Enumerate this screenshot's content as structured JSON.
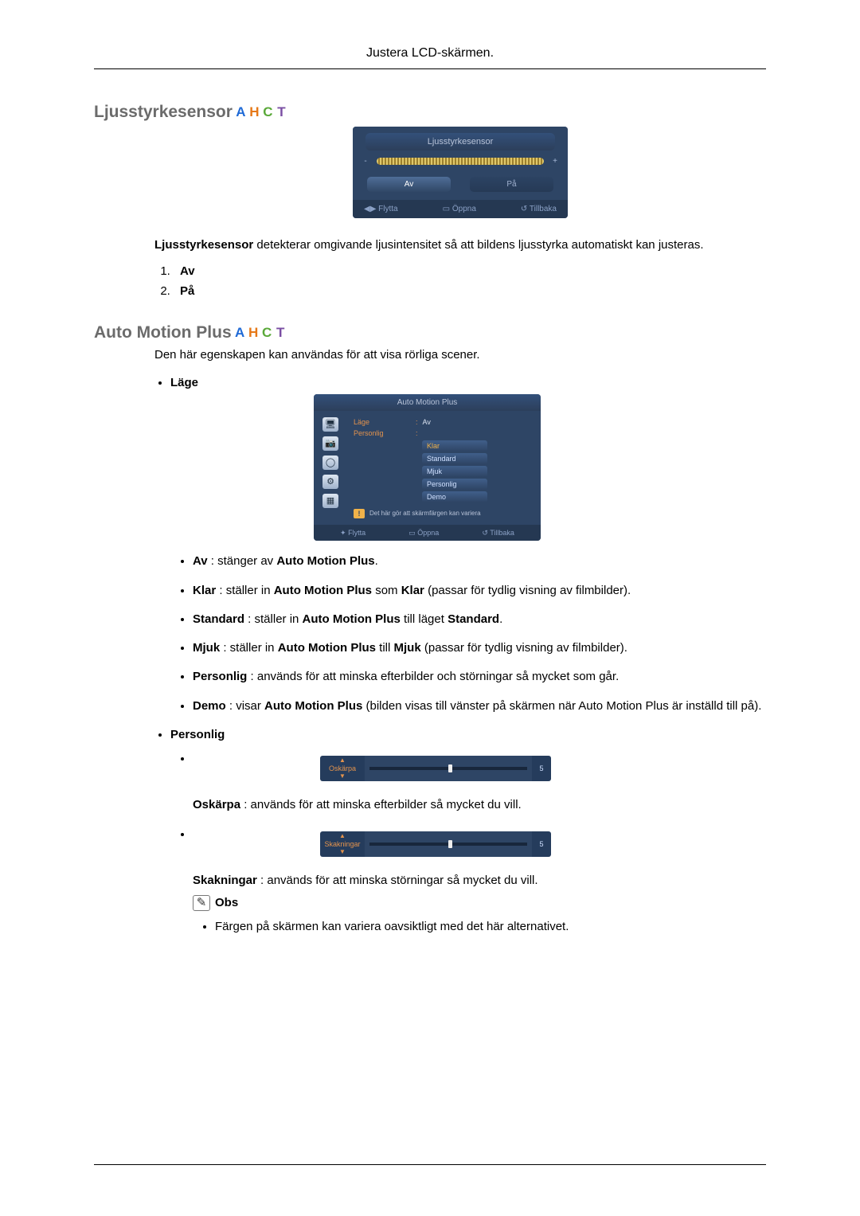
{
  "header": {
    "title": "Justera LCD-skärmen."
  },
  "section1": {
    "title": "Ljusstyrkesensor",
    "osd": {
      "title": "Ljusstyrkesensor",
      "minus": "-",
      "plus": "+",
      "opt_av": "Av",
      "opt_pa": "På",
      "foot_move": "Flytta",
      "foot_open": "Öppna",
      "foot_back": "Tillbaka"
    },
    "desc_pre": "Ljusstyrkesensor",
    "desc_post": " detekterar omgivande ljusintensitet så att bildens ljusstyrka automatiskt kan justeras.",
    "list": {
      "i1": "Av",
      "i2": "På"
    }
  },
  "section2": {
    "title": "Auto Motion Plus",
    "intro": "Den här egenskapen kan användas för att visa rörliga scener.",
    "mode_label": "Läge",
    "osd": {
      "title": "Auto Motion Plus",
      "row_mode": "Läge",
      "row_mode_val": "Av",
      "row_pers": "Personlig",
      "opts": {
        "klar": "Klar",
        "standard": "Standard",
        "mjuk": "Mjuk",
        "personlig": "Personlig",
        "demo": "Demo"
      },
      "warn": "Det här gör att skärmfärgen kan variera",
      "foot_move": "Flytta",
      "foot_open": "Öppna",
      "foot_back": "Tillbaka"
    },
    "bullets": {
      "av": {
        "b": "Av",
        "t": " : stänger av ",
        "b2": "Auto Motion Plus",
        "t2": "."
      },
      "klar": {
        "b": "Klar",
        "t": " : ställer in ",
        "b2": "Auto Motion Plus",
        "t2": " som ",
        "b3": "Klar",
        "t3": " (passar för tydlig visning av filmbilder)."
      },
      "std": {
        "b": "Standard",
        "t": " : ställer in ",
        "b2": "Auto Motion Plus",
        "t2": " till läget ",
        "b3": "Standard",
        "t3": "."
      },
      "mjuk": {
        "b": "Mjuk",
        "t": " : ställer in ",
        "b2": "Auto Motion Plus",
        "t2": " till ",
        "b3": "Mjuk",
        "t3": " (passar för tydlig visning av filmbilder)."
      },
      "pers": {
        "b": "Personlig",
        "t": " : används för att minska efterbilder och störningar så mycket som går."
      },
      "demo": {
        "b": "Demo",
        "t": " : visar ",
        "b2": "Auto Motion Plus",
        "t2": " (bilden visas till vänster på skärmen när Auto Motion Plus är inställd till på)."
      }
    },
    "personlig_label": "Personlig",
    "slider1": {
      "name": "Oskärpa",
      "value": "5",
      "desc_b": "Oskärpa",
      "desc_t": " : används för att minska efterbilder så mycket du vill."
    },
    "slider2": {
      "name": "Skakningar",
      "value": "5",
      "desc_b": "Skakningar",
      "desc_t": " : används för att minska störningar så mycket du vill."
    },
    "obs_label": "Obs",
    "obs_text": "Färgen på skärmen kan variera oavsiktligt med det här alternativet."
  }
}
